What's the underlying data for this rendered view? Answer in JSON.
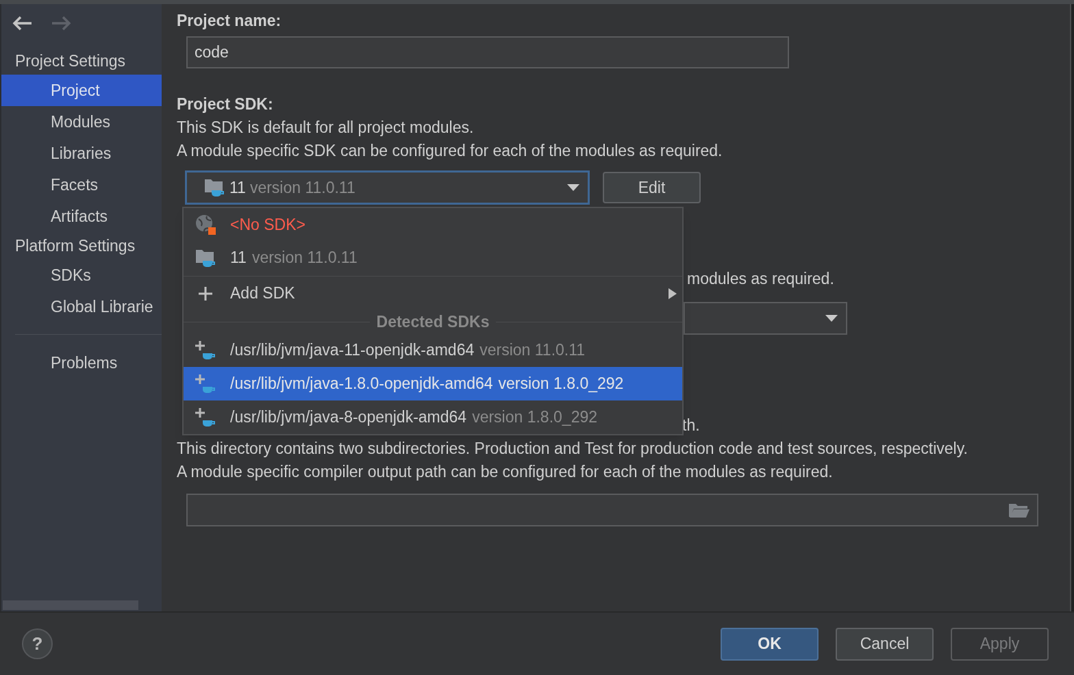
{
  "nav": {
    "back_enabled": true,
    "forward_enabled": false
  },
  "sidebar": {
    "sections": [
      {
        "heading": "Project Settings",
        "items": [
          {
            "label": "Project",
            "selected": true
          },
          {
            "label": "Modules",
            "selected": false
          },
          {
            "label": "Libraries",
            "selected": false
          },
          {
            "label": "Facets",
            "selected": false
          },
          {
            "label": "Artifacts",
            "selected": false
          }
        ]
      },
      {
        "heading": "Platform Settings",
        "items": [
          {
            "label": "SDKs",
            "selected": false
          },
          {
            "label": "Global Librarie",
            "selected": false
          }
        ]
      }
    ],
    "extra_items": [
      {
        "label": "Problems",
        "selected": false
      }
    ]
  },
  "project_name": {
    "label": "Project name:",
    "value": "code"
  },
  "project_sdk": {
    "label": "Project SDK:",
    "description": [
      "This SDK is default for all project modules.",
      "A module specific SDK can be configured for each of the modules as required."
    ],
    "combo": {
      "name": "11",
      "version": "version 11.0.11"
    },
    "edit_button": "Edit"
  },
  "language_level": {
    "trailing_text": "modules as required."
  },
  "compiler_output": {
    "trailing_text": "th.",
    "description": [
      "This directory contains two subdirectories. Production and Test for production code and test sources, respectively.",
      "A module specific compiler output path can be configured for each of the modules as required."
    ]
  },
  "sdk_popup": {
    "items": [
      {
        "kind": "no_sdk",
        "label": "<No SDK>",
        "selected": false
      },
      {
        "kind": "sdk",
        "name": "11",
        "version": "version 11.0.11",
        "selected": false
      },
      {
        "kind": "add",
        "label": "Add SDK"
      },
      {
        "kind": "header",
        "label": "Detected SDKs"
      },
      {
        "kind": "detected",
        "name": "/usr/lib/jvm/java-11-openjdk-amd64",
        "version": "version 11.0.11",
        "selected": false
      },
      {
        "kind": "detected",
        "name": "/usr/lib/jvm/java-1.8.0-openjdk-amd64",
        "version": "version 1.8.0_292",
        "selected": true
      },
      {
        "kind": "detected",
        "name": "/usr/lib/jvm/java-8-openjdk-amd64",
        "version": "version 1.8.0_292",
        "selected": false
      }
    ]
  },
  "help_button": "?",
  "buttons": [
    {
      "label": "OK",
      "kind": "default",
      "disabled": false
    },
    {
      "label": "Cancel",
      "kind": "normal",
      "disabled": false
    },
    {
      "label": "Apply",
      "kind": "normal",
      "disabled": true
    }
  ]
}
